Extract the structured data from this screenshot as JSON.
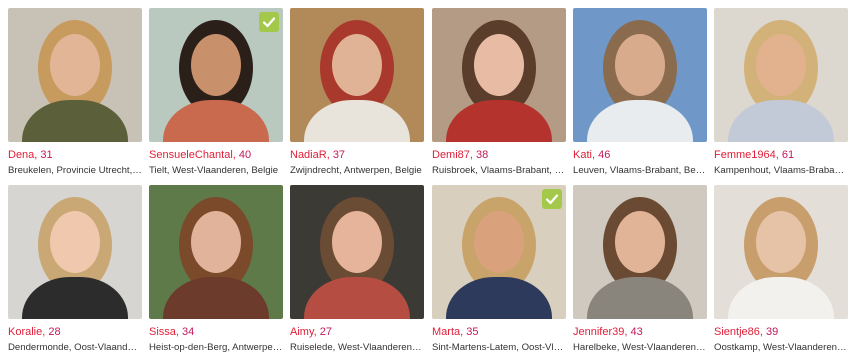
{
  "profiles": [
    {
      "name": "Dena",
      "age": "31",
      "location": "Breukelen, Provincie Utrecht, Nederland",
      "verified": false,
      "bg": "#c8c2b6",
      "skin": "#e2b596",
      "hair": "#c79a5e",
      "top": "#5b5f3a"
    },
    {
      "name": "SensueleChantal",
      "age": "40",
      "location": "Tielt, West-Vlaanderen, Belgie",
      "verified": true,
      "bg": "#b9c9c0",
      "skin": "#c9906c",
      "hair": "#2b2019",
      "top": "#c96a4f"
    },
    {
      "name": "NadiaR",
      "age": "37",
      "location": "Zwijndrecht, Antwerpen, Belgie",
      "verified": false,
      "bg": "#b28a5a",
      "skin": "#e0b396",
      "hair": "#a8392c",
      "top": "#e8e4dc"
    },
    {
      "name": "Demi87",
      "age": "38",
      "location": "Ruisbroek, Vlaams-Brabant, Belgie",
      "verified": false,
      "bg": "#b49b86",
      "skin": "#e8bca4",
      "hair": "#5a3d2a",
      "top": "#b4342d"
    },
    {
      "name": "Kati",
      "age": "46",
      "location": "Leuven, Vlaams-Brabant, Belgie",
      "verified": false,
      "bg": "#6f97c8",
      "skin": "#d9ab8d",
      "hair": "#8a6b4e",
      "top": "#e9ecef"
    },
    {
      "name": "Femme1964",
      "age": "61",
      "location": "Kampenhout, Vlaams-Brabant, Belgie",
      "verified": false,
      "bg": "#dcd7cf",
      "skin": "#e2b28f",
      "hair": "#d3b27a",
      "top": "#c2cad8"
    },
    {
      "name": "Koralie",
      "age": "28",
      "location": "Dendermonde, Oost-Vlaanderen, Belgie",
      "verified": false,
      "bg": "#d7d5d2",
      "skin": "#f0c8ad",
      "hair": "#c9a876",
      "top": "#2c2c2c"
    },
    {
      "name": "Sissa",
      "age": "34",
      "location": "Heist-op-den-Berg, Antwerpen, Belgie",
      "verified": false,
      "bg": "#5e7a48",
      "skin": "#e1b39a",
      "hair": "#7a4a2b",
      "top": "#6d3b2c"
    },
    {
      "name": "Aimy",
      "age": "27",
      "location": "Ruiselede, West-Vlaanderen, Belgie",
      "verified": false,
      "bg": "#3b3a34",
      "skin": "#e6b49a",
      "hair": "#6a4b34",
      "top": "#b54d43"
    },
    {
      "name": "Marta",
      "age": "35",
      "location": "Sint-Martens-Latem, Oost-Vlaanderen, Belgie",
      "verified": true,
      "bg": "#d9cfbf",
      "skin": "#d9a27c",
      "hair": "#c9a46a",
      "top": "#2e3a5c"
    },
    {
      "name": "Jennifer39",
      "age": "43",
      "location": "Harelbeke, West-Vlaanderen, Belgie",
      "verified": false,
      "bg": "#cfc9c0",
      "skin": "#e2b497",
      "hair": "#6b4a33",
      "top": "#8a857c"
    },
    {
      "name": "Sientje86",
      "age": "39",
      "location": "Oostkamp, West-Vlaanderen, Belgie",
      "verified": false,
      "bg": "#e3dfd8",
      "skin": "#e6c2a6",
      "hair": "#c89f6c",
      "top": "#f3f1ee"
    }
  ]
}
